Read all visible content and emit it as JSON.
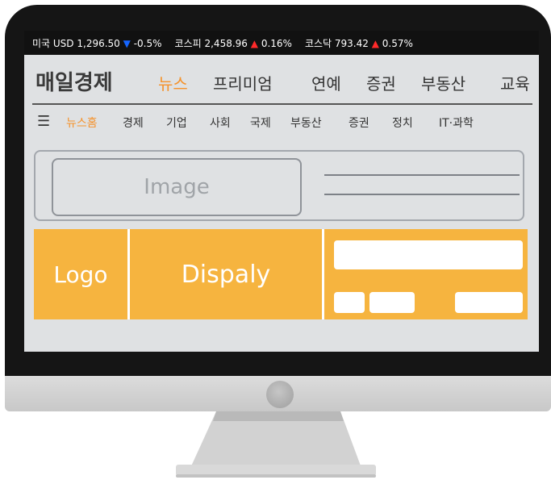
{
  "ticker": [
    {
      "label": "미국 USD",
      "value": "1,296.50",
      "dir": "down",
      "change": "-0.5%"
    },
    {
      "label": "코스피",
      "value": "2,458.96",
      "dir": "up",
      "change": "0.16%"
    },
    {
      "label": "코스닥",
      "value": "793.42",
      "dir": "up",
      "change": "0.57%"
    }
  ],
  "header": {
    "logo": "매일경제",
    "nav": [
      "뉴스",
      "프리미엄",
      "연예",
      "증권",
      "부동산",
      "교육"
    ]
  },
  "subnav": {
    "menu_icon": "☰",
    "items": [
      "뉴스홈",
      "경제",
      "기업",
      "사회",
      "국제",
      "부동산",
      "증권",
      "정치",
      "IT·과학"
    ]
  },
  "card": {
    "image_label": "Image"
  },
  "banner": {
    "logo_label": "Logo",
    "display_label": "Dispaly"
  },
  "colors": {
    "accent": "#f5922b",
    "banner": "#f6b43f",
    "up": "#ff2a2a",
    "down": "#1565ff"
  }
}
